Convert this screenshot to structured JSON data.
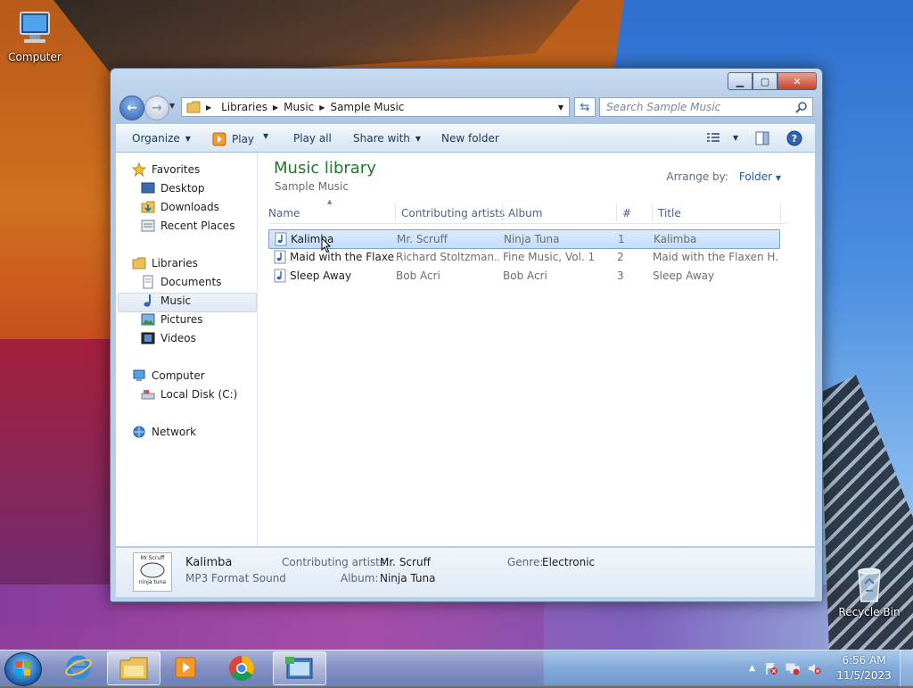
{
  "desktop": {
    "computer_label": "Computer",
    "recycle_label": "Recycle Bin"
  },
  "window": {
    "address": {
      "segments": [
        "Libraries",
        "Music",
        "Sample Music"
      ]
    },
    "search_placeholder": "Search Sample Music",
    "commands": {
      "organize": "Organize",
      "play": "Play",
      "play_all": "Play all",
      "share_with": "Share with",
      "new_folder": "New folder"
    },
    "nav": {
      "favorites": "Favorites",
      "desktop": "Desktop",
      "downloads": "Downloads",
      "recent": "Recent Places",
      "libraries": "Libraries",
      "documents": "Documents",
      "music": "Music",
      "pictures": "Pictures",
      "videos": "Videos",
      "computer": "Computer",
      "local_disk": "Local Disk (C:)",
      "network": "Network"
    },
    "library": {
      "title": "Music library",
      "subtitle": "Sample Music",
      "arrange_label": "Arrange by:",
      "arrange_value": "Folder"
    },
    "columns": {
      "name": "Name",
      "artists": "Contributing artists",
      "album": "Album",
      "num": "#",
      "title": "Title"
    },
    "rows": [
      {
        "name": "Kalimba",
        "artist": "Mr. Scruff",
        "album": "Ninja Tuna",
        "num": "1",
        "title": "Kalimba"
      },
      {
        "name": "Maid with the Flaxe...",
        "artist": "Richard Stoltzman...",
        "album": "Fine Music, Vol. 1",
        "num": "2",
        "title": "Maid with the Flaxen H..."
      },
      {
        "name": "Sleep Away",
        "artist": "Bob Acri",
        "album": "Bob Acri",
        "num": "3",
        "title": "Sleep Away"
      }
    ],
    "details": {
      "art_text_top": "Mr.Scruff",
      "art_text_bottom": "ninja tuna",
      "name": "Kalimba",
      "type": "MP3 Format Sound",
      "artists_label": "Contributing artists:",
      "artists_value": "Mr. Scruff",
      "album_label": "Album:",
      "album_value": "Ninja Tuna",
      "genre_label": "Genre:",
      "genre_value": "Electronic"
    }
  },
  "taskbar": {
    "time": "6:56 AM",
    "date": "11/5/2023"
  },
  "colors": {
    "accent_green": "#1e7a2e",
    "link_blue": "#1f5ca8",
    "selection": "#c1dcfc"
  }
}
